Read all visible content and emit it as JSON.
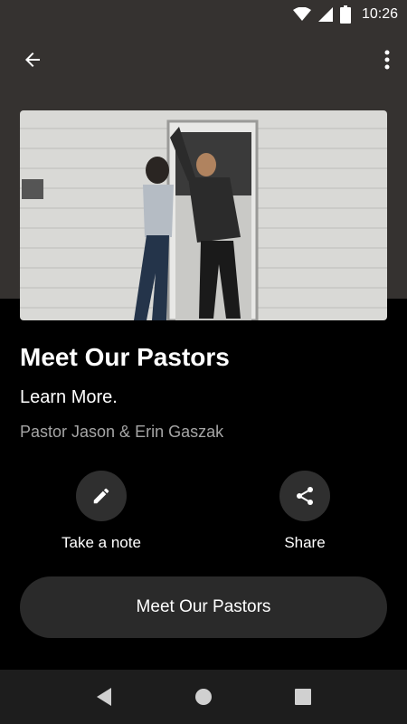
{
  "status_bar": {
    "time": "10:26",
    "icons": [
      "wifi-icon",
      "cell-signal-icon",
      "battery-icon"
    ]
  },
  "app_bar": {
    "back_icon": "arrow-left-icon",
    "menu_icon": "more-vert-icon"
  },
  "hero_image": {
    "description_icon": "photo"
  },
  "content": {
    "title": "Meet Our Pastors",
    "subtitle": "Learn More.",
    "author": "Pastor Jason & Erin Gaszak"
  },
  "actions": [
    {
      "label": "Take a note",
      "icon": "pencil-icon"
    },
    {
      "label": "Share",
      "icon": "share-icon"
    }
  ],
  "cta": {
    "label": "Meet Our Pastors"
  },
  "nav_bar": {
    "icons": [
      "back-triangle-icon",
      "home-circle-icon",
      "recents-square-icon"
    ]
  },
  "colors": {
    "header_bg": "#353230",
    "page_bg": "#000000",
    "button_bg": "#2a2a2a",
    "muted_text": "#a5a5a5"
  }
}
